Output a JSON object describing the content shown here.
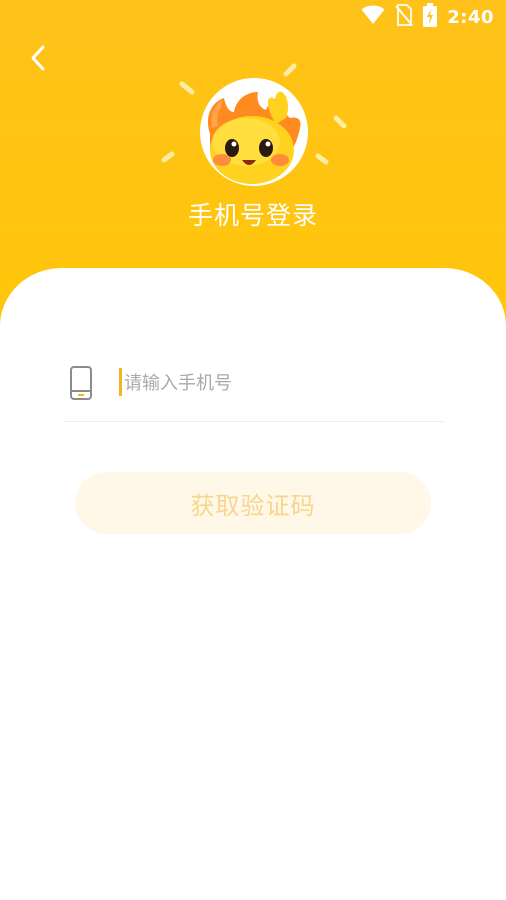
{
  "status_bar": {
    "time": "2:40",
    "icons": [
      "wifi-icon",
      "no-sim-icon",
      "battery-charging-icon"
    ]
  },
  "header": {
    "back_icon": "chevron-left-icon",
    "title": "手机号登录",
    "mascot": "sun-mascot-icon"
  },
  "form": {
    "phone_icon": "phone-icon",
    "phone_value": "",
    "phone_placeholder": "请输入手机号",
    "get_code_label": "获取验证码"
  },
  "colors": {
    "header_yellow": "#FFC21A",
    "accent": "#F5B51E",
    "button_bg_disabled": "#FFF8E8",
    "button_text_disabled": "#F7D58D",
    "placeholder": "#A9A9A9"
  }
}
